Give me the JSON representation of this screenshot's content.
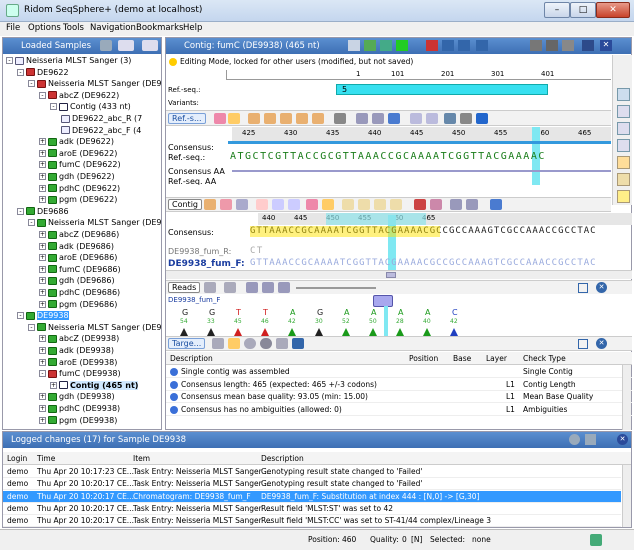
{
  "window": {
    "title": "Ridom SeqSphere+ (demo at localhost)",
    "min": "–",
    "max": "□",
    "close": "✕"
  },
  "menu": [
    "File",
    "Options",
    "Tools",
    "Navigation",
    "Bookmarks",
    "Help"
  ],
  "left": {
    "header": "Loaded Samples",
    "tree": [
      {
        "t": "Neisseria MLST Sanger  (3)",
        "lv": 0,
        "icon": "doc",
        "exp": "-"
      },
      {
        "t": "DE9622",
        "lv": 1,
        "icon": "red",
        "exp": "-"
      },
      {
        "t": "Neisseria MLST Sanger (DE96",
        "lv": 2,
        "icon": "red",
        "exp": "-"
      },
      {
        "t": "abcZ (DE9622)",
        "lv": 3,
        "icon": "red",
        "exp": "-"
      },
      {
        "t": "Contig (433 nt)",
        "lv": 4,
        "icon": "contig",
        "exp": "-"
      },
      {
        "t": "DE9622_abc_R (7",
        "lv": 5,
        "icon": "doc",
        "exp": ""
      },
      {
        "t": "DE9622_abc_F (4",
        "lv": 5,
        "icon": "doc",
        "exp": ""
      },
      {
        "t": "adk (DE9622)",
        "lv": 3,
        "icon": "green",
        "exp": "+"
      },
      {
        "t": "aroE (DE9622)",
        "lv": 3,
        "icon": "green",
        "exp": "+"
      },
      {
        "t": "fumC (DE9622)",
        "lv": 3,
        "icon": "green",
        "exp": "+"
      },
      {
        "t": "gdh (DE9622)",
        "lv": 3,
        "icon": "green",
        "exp": "+"
      },
      {
        "t": "pdhC (DE9622)",
        "lv": 3,
        "icon": "green",
        "exp": "+"
      },
      {
        "t": "pgm (DE9622)",
        "lv": 3,
        "icon": "green",
        "exp": "+"
      },
      {
        "t": "DE9686",
        "lv": 1,
        "icon": "green",
        "exp": "-"
      },
      {
        "t": "Neisseria MLST Sanger (DE96",
        "lv": 2,
        "icon": "green",
        "exp": "-"
      },
      {
        "t": "abcZ (DE9686)",
        "lv": 3,
        "icon": "green",
        "exp": "+"
      },
      {
        "t": "adk (DE9686)",
        "lv": 3,
        "icon": "green",
        "exp": "+"
      },
      {
        "t": "aroE (DE9686)",
        "lv": 3,
        "icon": "green",
        "exp": "+"
      },
      {
        "t": "fumC (DE9686)",
        "lv": 3,
        "icon": "green",
        "exp": "+"
      },
      {
        "t": "gdh (DE9686)",
        "lv": 3,
        "icon": "green",
        "exp": "+"
      },
      {
        "t": "pdhC (DE9686)",
        "lv": 3,
        "icon": "green",
        "exp": "+"
      },
      {
        "t": "pgm (DE9686)",
        "lv": 3,
        "icon": "green",
        "exp": "+"
      },
      {
        "t": "DE9938",
        "lv": 1,
        "icon": "green",
        "exp": "-",
        "sel": true
      },
      {
        "t": "Neisseria MLST Sanger (DE99",
        "lv": 2,
        "icon": "green",
        "exp": "-"
      },
      {
        "t": "abcZ (DE9938)",
        "lv": 3,
        "icon": "green",
        "exp": "+"
      },
      {
        "t": "adk (DE9938)",
        "lv": 3,
        "icon": "green",
        "exp": "+"
      },
      {
        "t": "aroE (DE9938)",
        "lv": 3,
        "icon": "green",
        "exp": "+"
      },
      {
        "t": "fumC (DE9938)",
        "lv": 3,
        "icon": "red",
        "exp": "-"
      },
      {
        "t": "Contig (465 nt)",
        "lv": 4,
        "icon": "contig",
        "exp": "+",
        "bold": true
      },
      {
        "t": "gdh (DE9938)",
        "lv": 3,
        "icon": "green",
        "exp": "+"
      },
      {
        "t": "pdhC (DE9938)",
        "lv": 3,
        "icon": "green",
        "exp": "+"
      },
      {
        "t": "pgm (DE9938)",
        "lv": 3,
        "icon": "green",
        "exp": "+"
      }
    ]
  },
  "contig": {
    "header": "Contig: fumC (DE9938) (465 nt)",
    "editing": "Editing Mode, locked for other users (modified, but not saved)",
    "ruler": [
      "1",
      "101",
      "201",
      "301",
      "401"
    ],
    "refseq_label": "Ref.-seq.:",
    "variants_label": "Variants:",
    "arrow": "5",
    "ref_btn": "Ref.-s...",
    "pos_ticks": [
      "425",
      "430",
      "435",
      "440",
      "445",
      "450",
      "455",
      "460",
      "465"
    ],
    "consensus_label": "Consensus:",
    "refseq2_label": "Ref.-seq.:",
    "seq1": "ATGCTCGTTACCGCGTTAAACCGCAAAATCGGTTACGAAAAC",
    "consensus_aa": "Consensus AA",
    "refseq_aa": "Ref.-seq. AA"
  },
  "contigpanel": {
    "tab": "Contig",
    "ticks": [
      "440",
      "445",
      "450",
      "455",
      "460",
      "465"
    ],
    "consensus_label": "Consensus:",
    "seq_consensus": "GTTAAACCGCAAAATCGGTTACGAAAACGCCGCCAAAGTCGCCAAACCGCCTAC",
    "read_r_label": "DE9938_fum_R:",
    "read_r_seq": "CT",
    "read_f_label": "DE9938_fum_F:",
    "read_f_seq": "GTTAAACCGCAAAATCGGTTACGAAAACGCCGCCAAAGTCGCCAAACCGCCTAC"
  },
  "reads": {
    "tab": "Reads",
    "read_name": "DE9938_fum_F",
    "bases": [
      {
        "b": "G",
        "n": "54"
      },
      {
        "b": "G",
        "n": "33"
      },
      {
        "b": "T",
        "n": "45"
      },
      {
        "b": "T",
        "n": "46"
      },
      {
        "b": "A",
        "n": "42"
      },
      {
        "b": "G",
        "n": "30"
      },
      {
        "b": "A",
        "n": "52"
      },
      {
        "b": "A",
        "n": "50"
      },
      {
        "b": "A",
        "n": "28"
      },
      {
        "b": "A",
        "n": "40"
      },
      {
        "b": "C",
        "n": "42"
      }
    ]
  },
  "targets": {
    "tab": "Targe...",
    "cols": [
      "Description",
      "Position",
      "Base",
      "Layer",
      "Check Type"
    ],
    "rows": [
      {
        "d": "Single contig was assembled",
        "p": "",
        "b": "",
        "l": "",
        "c": "Single Contig"
      },
      {
        "d": "Consensus length: 465 (expected: 465 +/-3 codons)",
        "p": "",
        "b": "",
        "l": "L1",
        "c": "Contig Length"
      },
      {
        "d": "Consensus mean base quality: 93.05 (min: 15.00)",
        "p": "",
        "b": "",
        "l": "L1",
        "c": "Mean Base Quality"
      },
      {
        "d": "Consensus has no ambiguities (allowed: 0)",
        "p": "",
        "b": "",
        "l": "L1",
        "c": "Ambiguities"
      }
    ]
  },
  "log": {
    "header": "Logged changes (17) for Sample DE9938",
    "cols": [
      "Login",
      "Time",
      "Item",
      "Description"
    ],
    "rows": [
      {
        "l": "demo",
        "t": "Thu Apr 20 10:17:23 CE...",
        "i": "Task Entry: Neisseria MLST Sanger ...",
        "d": "Genotyping result state changed to 'Failed'",
        "sel": false
      },
      {
        "l": "demo",
        "t": "Thu Apr 20 10:20:17 CE...",
        "i": "Task Entry: Neisseria MLST Sanger ...",
        "d": "Genotyping result state changed to 'Failed'",
        "sel": false
      },
      {
        "l": "demo",
        "t": "Thu Apr 20 10:20:17 CE...",
        "i": "Chromatogram: DE9938_fum_F",
        "d": "DE9938_fum_F: Substitution at index 444 : [N,0] -> [G,30]",
        "sel": true
      },
      {
        "l": "demo",
        "t": "Thu Apr 20 10:20:17 CE...",
        "i": "Task Entry: Neisseria MLST Sanger ...",
        "d": "Result field 'MLST:ST' was set to 42",
        "sel": false
      },
      {
        "l": "demo",
        "t": "Thu Apr 20 10:20:17 CE...",
        "i": "Task Entry: Neisseria MLST Sanger ...",
        "d": "Result field 'MLST:CC' was set to ST-41/44 complex/Lineage 3",
        "sel": false
      }
    ]
  },
  "status": {
    "position_label": "Position:",
    "position": "460",
    "quality_label": "Quality:",
    "quality": "0",
    "quality_tag": "[N]",
    "selected_label": "Selected:",
    "selected": "none"
  }
}
